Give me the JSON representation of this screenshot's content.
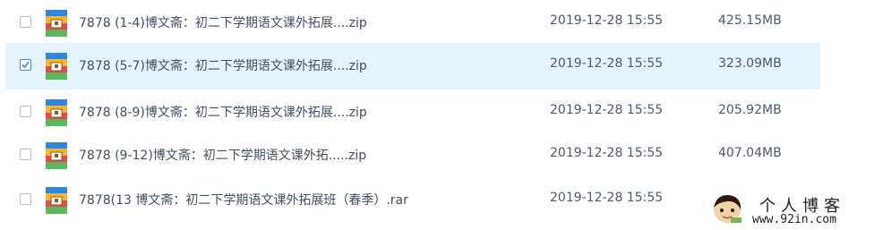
{
  "files": [
    {
      "name": "7878 (1-4)博文斋：初二下学期语文课外拓展....zip",
      "date": "2019-12-28 15:55",
      "size": "425.15MB",
      "checked": false
    },
    {
      "name": "7878 (5-7)博文斋：初二下学期语文课外拓展....zip",
      "date": "2019-12-28 15:55",
      "size": "323.09MB",
      "checked": true
    },
    {
      "name": "7878 (8-9)博文斋：初二下学期语文课外拓展....zip",
      "date": "2019-12-28 15:55",
      "size": "205.92MB",
      "checked": false
    },
    {
      "name": "7878 (9-12)博文斋：初二下学期语文课外拓.....zip",
      "date": "2019-12-28 15:55",
      "size": "407.04MB",
      "checked": false
    },
    {
      "name": "7878(13 博文斋：初二下学期语文课外拓展班（春季）.rar",
      "date": "2019-12-28 15:55",
      "size": "",
      "checked": false
    }
  ],
  "watermark": {
    "title": "个人博客",
    "url": "www.92in.com"
  },
  "colors": {
    "selected_row": "#e5f3fc",
    "checkbox_checked": "#4a8ae0",
    "text": "#424e67"
  },
  "icons": {
    "file": "archive-file-icon",
    "check": "checkmark-icon"
  }
}
